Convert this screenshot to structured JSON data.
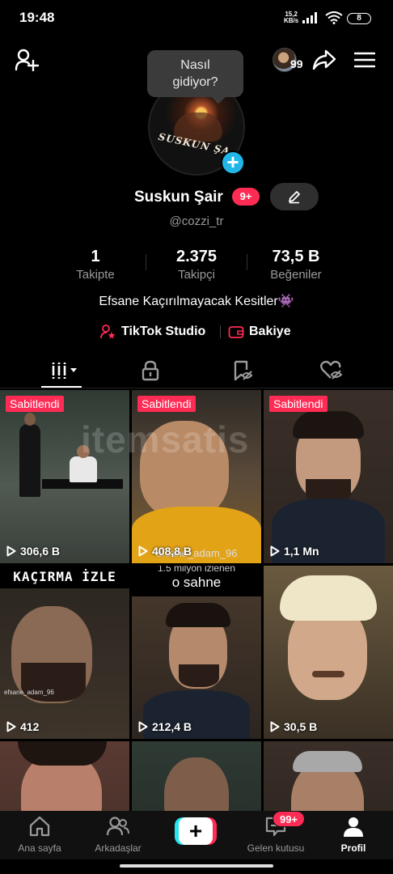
{
  "status_bar": {
    "time": "19:48",
    "speed_value": "15,2",
    "speed_unit": "KB/s",
    "battery": "8"
  },
  "header": {
    "friend_count": "99"
  },
  "tooltip": {
    "line1": "Nasıl",
    "line2": "gidiyor?"
  },
  "avatar": {
    "overlay_text": "SUSKUN ŞA"
  },
  "profile": {
    "name": "Suskun Şair",
    "badge": "9+",
    "handle": "@cozzi_tr",
    "bio": "Efsane Kaçırılmayacak Kesitler👾"
  },
  "stats": {
    "following": {
      "value": "1",
      "label": "Takipte"
    },
    "followers": {
      "value": "2.375",
      "label": "Takipçi"
    },
    "likes": {
      "value": "73,5 B",
      "label": "Beğeniler"
    }
  },
  "links": {
    "studio": "TikTok Studio",
    "wallet": "Bakiye"
  },
  "watermark": "itemsatis",
  "grid": {
    "pinned_label": "Sabitlendi",
    "videos": [
      {
        "views": "306,6 B",
        "pinned": true
      },
      {
        "views": "408,8 B",
        "pinned": true,
        "watermark": "efsane_adam_96"
      },
      {
        "views": "1,1 Mn",
        "pinned": true
      },
      {
        "views": "412",
        "top_text": "KAÇIRMA İZLE",
        "watermark": "efsane_adam_96"
      },
      {
        "views": "212,4 B",
        "top_text_1": "1.5 milyon izlenen",
        "top_text_2": "o sahne"
      },
      {
        "views": "30,5 B"
      }
    ]
  },
  "bottom_nav": {
    "home": "Ana sayfa",
    "friends": "Arkadaşlar",
    "inbox": "Gelen kutusu",
    "inbox_badge": "99+",
    "profile": "Profil"
  },
  "colors": {
    "accent": "#fe2c55",
    "plus_badge": "#20b7e8",
    "background": "#000000"
  }
}
